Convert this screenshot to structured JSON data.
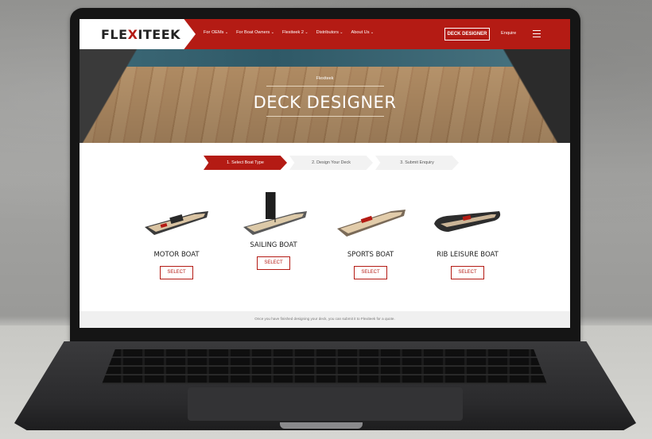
{
  "site": {
    "logo": {
      "left": "FLE",
      "x": "X",
      "right": "ITEEK"
    },
    "nav": [
      "For OEMs",
      "For Boat Owners",
      "Flexiteek 2",
      "Distributors",
      "About Us"
    ],
    "cta_label": "DECK DESIGNER",
    "enquire_label": "Enquire",
    "hero": {
      "kicker": "Flexiteek",
      "title": "DECK DESIGNER"
    },
    "steps": [
      "1. Select Boat Type",
      "2. Design Your Deck",
      "3. Submit Enquiry"
    ],
    "boats": [
      {
        "name": "MOTOR BOAT",
        "button": "SELECT"
      },
      {
        "name": "SAILING BOAT",
        "button": "SELECT"
      },
      {
        "name": "SPORTS BOAT",
        "button": "SELECT"
      },
      {
        "name": "RIB LEISURE BOAT",
        "button": "SELECT"
      }
    ],
    "footer_note": "Once you have finished designing your deck, you can submit it to Flexiteek for a quote.",
    "colors": {
      "brand_red": "#b41b14"
    }
  }
}
